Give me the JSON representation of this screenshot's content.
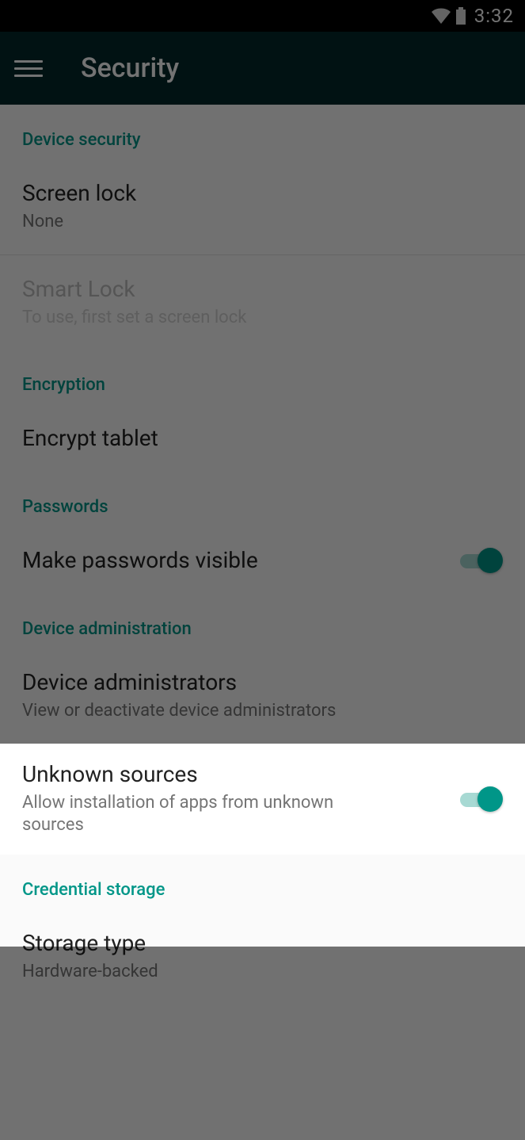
{
  "status": {
    "time": "3:32"
  },
  "appbar": {
    "title": "Security"
  },
  "sections": {
    "device_security": {
      "header": "Device security"
    },
    "encryption": {
      "header": "Encryption"
    },
    "passwords": {
      "header": "Passwords"
    },
    "device_admin": {
      "header": "Device administration"
    },
    "credential": {
      "header": "Credential storage"
    }
  },
  "items": {
    "screen_lock": {
      "title": "Screen lock",
      "sub": "None"
    },
    "smart_lock": {
      "title": "Smart Lock",
      "sub": "To use, first set a screen lock"
    },
    "encrypt": {
      "title": "Encrypt tablet"
    },
    "passwords_visible": {
      "title": "Make passwords visible",
      "on": true
    },
    "device_admins": {
      "title": "Device administrators",
      "sub": "View or deactivate device administrators"
    },
    "unknown_sources": {
      "title": "Unknown sources",
      "sub": "Allow installation of apps from unknown sources",
      "on": true
    },
    "storage_type": {
      "title": "Storage type",
      "sub": "Hardware-backed"
    }
  }
}
